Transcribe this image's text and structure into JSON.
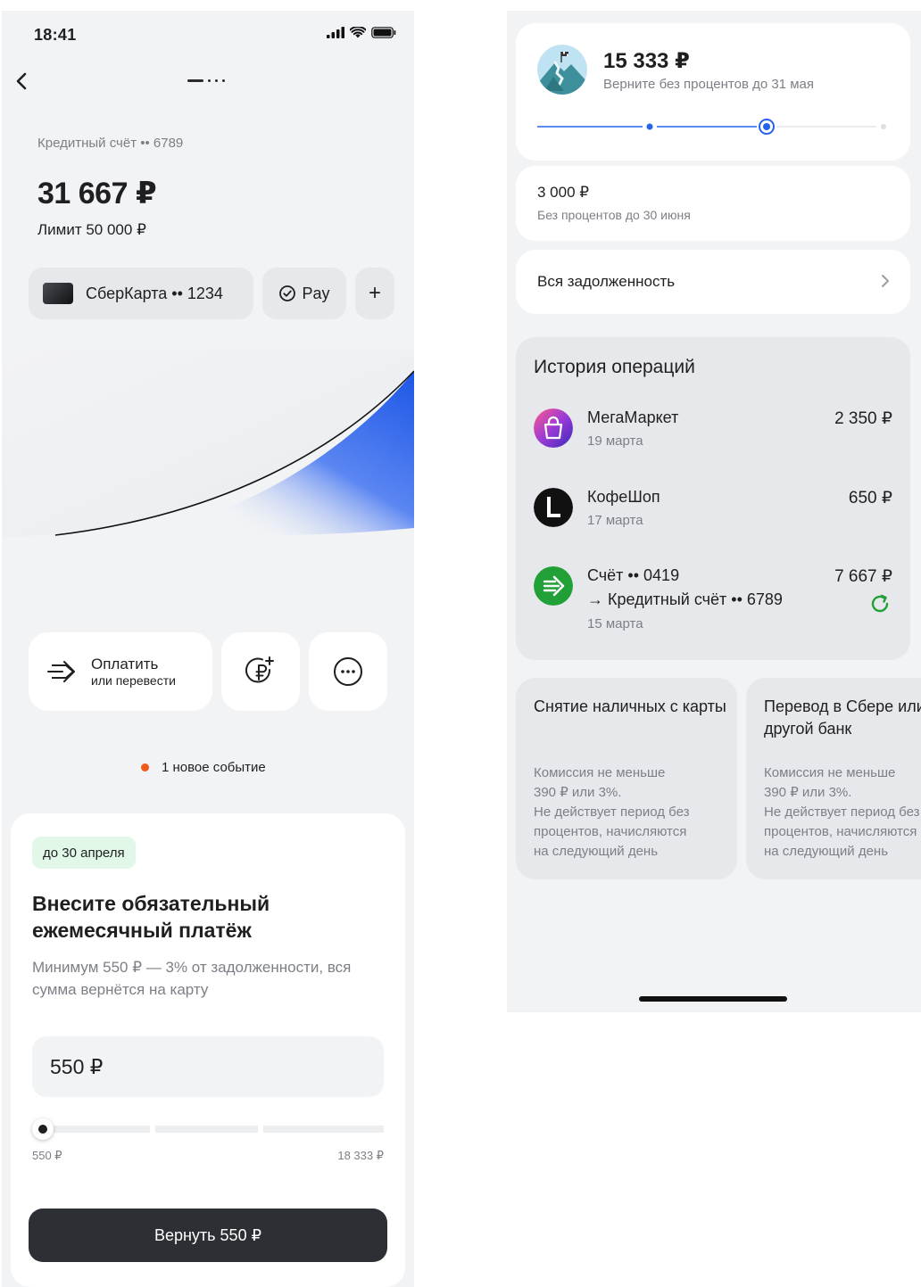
{
  "left": {
    "status": {
      "time": "18:41"
    },
    "account": {
      "label": "Кредитный счёт •• 6789",
      "balance": "31 667 ₽",
      "limit": "Лимит 50 000 ₽"
    },
    "chips": {
      "card": "СберКарта •• 1234",
      "pay": "Pay",
      "add": "+"
    },
    "actions": {
      "pay_title": "Оплатить",
      "pay_subtitle": "или перевести",
      "topup_icon": "ruble-plus-icon",
      "more_icon": "more-icon"
    },
    "event": "1 новое событие",
    "payment": {
      "badge": "до 30 апреля",
      "title": "Внесите обязательный ежемесячный платёж",
      "subtitle": "Минимум 550 ₽ — 3% от задолженности, вся сумма вернётся на карту",
      "amount": "550 ₽",
      "slider_min": "550 ₽",
      "slider_max": "18 333 ₽",
      "slider_fraction": 0,
      "button": "Вернуть 550 ₽"
    }
  },
  "right": {
    "goal": {
      "amount": "15 333 ₽",
      "subtitle": "Верните без процентов до 31 мая",
      "progress_step": 2,
      "progress_total": 3
    },
    "free": {
      "amount": "3 000 ₽",
      "subtitle": "Без процентов до 30 июня"
    },
    "debt": {
      "label": "Вся задолженность"
    },
    "history": {
      "title": "История операций",
      "items": [
        {
          "name": "МегаМаркет",
          "date": "19 марта",
          "amount": "2 350 ₽",
          "icon": "megamarket-icon"
        },
        {
          "name": "КофеШоп",
          "date": "17 марта",
          "amount": "650 ₽",
          "icon": "coffee-shop-icon"
        },
        {
          "name": "Счёт •• 0419",
          "line2": "→ Кредитный счёт •• 6789",
          "date": "15 марта",
          "amount": "7 667 ₽",
          "icon": "transfer-icon"
        }
      ]
    },
    "info": [
      {
        "title": "Снятие наличных с карты",
        "text": [
          "Комиссия не меньше",
          "390 ₽ или 3%.",
          "Не действует период без",
          "процентов, начисляются",
          "на следующий день"
        ]
      },
      {
        "title": "Перевод в Сбере или в другой банк",
        "text": [
          "Комиссия не меньше",
          "390 ₽ или 3%.",
          "Не действует период без",
          "процентов, начисляются",
          "на следующий день"
        ]
      }
    ]
  },
  "colors": {
    "accent_blue": "#2563eb",
    "success_green": "#21a038",
    "event_orange": "#f05a19",
    "button_dark": "#2c2f33"
  }
}
